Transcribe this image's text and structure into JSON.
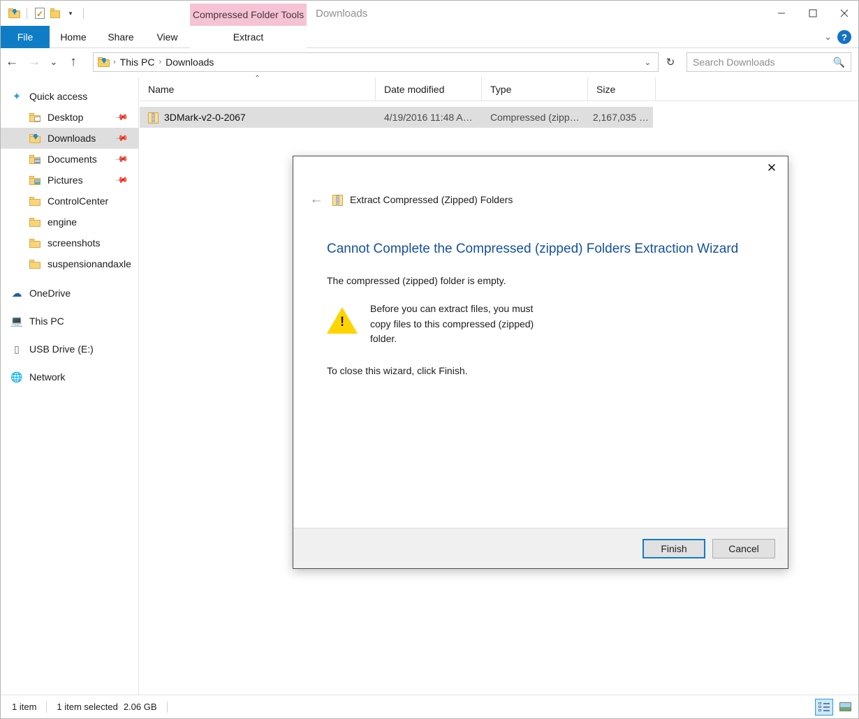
{
  "window": {
    "title": "Downloads",
    "contextual_tab_group": "Compressed Folder Tools",
    "quick_access": [
      {
        "name": "downloads-folder-icon",
        "label": "Downloads folder"
      },
      {
        "name": "properties-icon",
        "label": "Properties"
      },
      {
        "name": "new-folder-icon",
        "label": "New folder"
      },
      {
        "name": "customize-caret",
        "label": "▾"
      }
    ],
    "controls": {
      "minimize": "─",
      "maximize": "□",
      "close": "✕",
      "ribbon_chevron": "⌄",
      "help": "?"
    }
  },
  "ribbon": {
    "tabs": [
      {
        "label": "File",
        "active": false
      },
      {
        "label": "Home",
        "active": false
      },
      {
        "label": "Share",
        "active": false
      },
      {
        "label": "View",
        "active": false
      },
      {
        "label": "Extract",
        "active": true
      }
    ]
  },
  "address": {
    "back": "←",
    "forward": "→",
    "recent": "⌄",
    "up": "↑",
    "crumbs": [
      "This PC",
      "Downloads"
    ],
    "separator": "›",
    "dropdown_caret": "⌄",
    "refresh": "↻"
  },
  "search": {
    "placeholder": "Search Downloads",
    "value": "",
    "icon": "search-icon"
  },
  "sidebar": {
    "items": [
      {
        "label": "Quick access",
        "icon": "star-icon",
        "level": 0,
        "selected": false,
        "pinned": false
      },
      {
        "label": "Desktop",
        "icon": "folder-desktop-icon",
        "level": 1,
        "selected": false,
        "pinned": true
      },
      {
        "label": "Downloads",
        "icon": "folder-downloads-icon",
        "level": 1,
        "selected": true,
        "pinned": true
      },
      {
        "label": "Documents",
        "icon": "folder-documents-icon",
        "level": 1,
        "selected": false,
        "pinned": true
      },
      {
        "label": "Pictures",
        "icon": "folder-pictures-icon",
        "level": 1,
        "selected": false,
        "pinned": true
      },
      {
        "label": "ControlCenter",
        "icon": "folder-icon",
        "level": 1,
        "selected": false,
        "pinned": false
      },
      {
        "label": "engine",
        "icon": "folder-icon",
        "level": 1,
        "selected": false,
        "pinned": false
      },
      {
        "label": "screenshots",
        "icon": "folder-icon",
        "level": 1,
        "selected": false,
        "pinned": false
      },
      {
        "label": "suspensionandaxle",
        "icon": "folder-icon",
        "level": 1,
        "selected": false,
        "pinned": false
      },
      {
        "label": "OneDrive",
        "icon": "cloud-icon",
        "level": 0,
        "selected": false,
        "pinned": false
      },
      {
        "label": "This PC",
        "icon": "computer-icon",
        "level": 0,
        "selected": false,
        "pinned": false
      },
      {
        "label": "USB Drive (E:)",
        "icon": "usb-drive-icon",
        "level": 0,
        "selected": false,
        "pinned": false
      },
      {
        "label": "Network",
        "icon": "network-icon",
        "level": 0,
        "selected": false,
        "pinned": false
      }
    ],
    "pin_glyph": "✒"
  },
  "filelist": {
    "columns": [
      {
        "label": "Name",
        "sorted": true,
        "sort_dir": "asc"
      },
      {
        "label": "Date modified",
        "sorted": false
      },
      {
        "label": "Type",
        "sorted": false
      },
      {
        "label": "Size",
        "sorted": false
      }
    ],
    "sort_caret": "⌃",
    "rows": [
      {
        "name": "3DMark-v2-0-2067",
        "date_modified": "4/19/2016 11:48 A…",
        "type": "Compressed (zipp…",
        "size": "2,167,035 …",
        "icon": "zip-folder-icon",
        "selected": true
      }
    ]
  },
  "statusbar": {
    "item_count": "1 item",
    "selection": "1 item selected",
    "selection_size": "2.06 GB",
    "views": [
      {
        "name": "details-view-button",
        "active": true
      },
      {
        "name": "large-icons-view-button",
        "active": false
      }
    ]
  },
  "dialog": {
    "close_glyph": "✕",
    "back_glyph": "←",
    "nav_title": "Extract Compressed (Zipped) Folders",
    "nav_icon": "zip-folder-icon",
    "heading": "Cannot Complete the Compressed (zipped) Folders Extraction Wizard",
    "paragraph_1": "The compressed (zipped) folder is empty.",
    "warning_icon": "warning-triangle-icon",
    "warning_text": "Before you can extract files, you must copy files to this compressed (zipped) folder.",
    "paragraph_2": "To close this wizard, click Finish.",
    "buttons": [
      {
        "label": "Finish",
        "default": true
      },
      {
        "label": "Cancel",
        "default": false
      }
    ]
  },
  "colors": {
    "accent_blue": "#0f7dc6",
    "contextual_pink": "#f6c3d4",
    "heading_blue": "#13509e",
    "warning_yellow": "#ffd400",
    "selection_gray": "#dedede"
  }
}
